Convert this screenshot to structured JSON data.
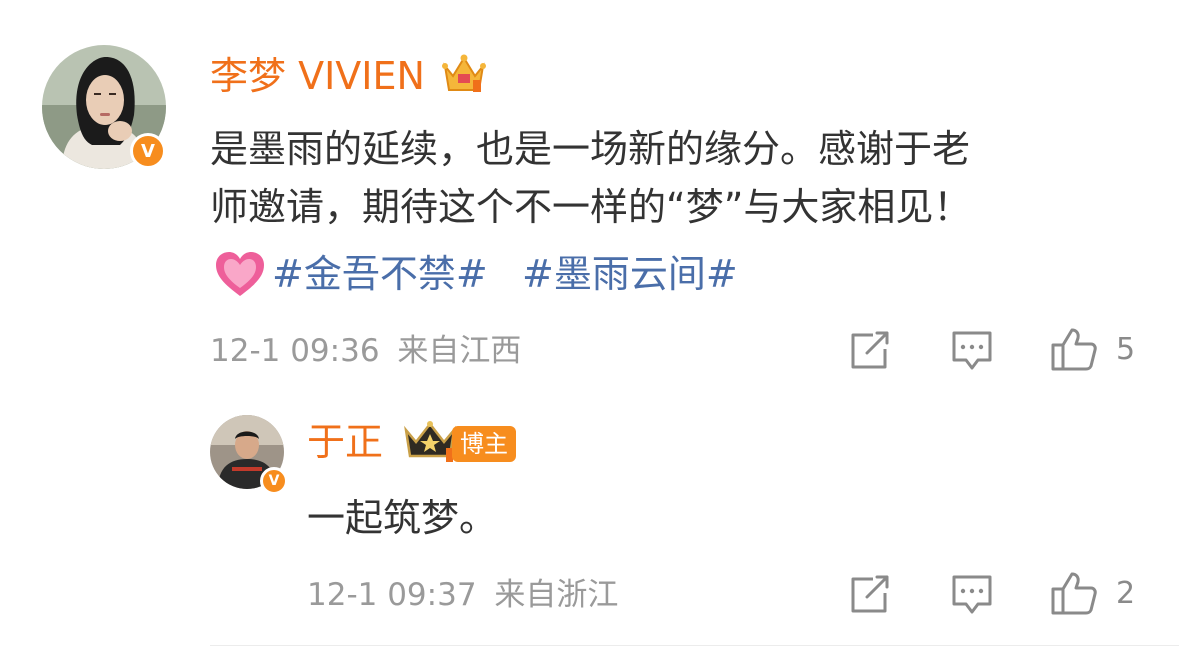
{
  "comment1": {
    "username": "李梦 VIVIEN",
    "content_line1": "是墨雨的延续，也是一场新的缘分。感谢于老",
    "content_line2": "师邀请，期待这个不一样的“梦”与大家相见！",
    "hashtag1": "#金吾不禁#",
    "hashtag2": "#墨雨云间#",
    "timestamp": "12-1 09:36",
    "location": "来自江西",
    "like_count": "5",
    "verified_badge": "V"
  },
  "reply1": {
    "username": "于正",
    "badge_label": "博主",
    "content": "一起筑梦。",
    "timestamp": "12-1 09:37",
    "location": "来自浙江",
    "like_count": "2",
    "verified_badge": "V"
  },
  "icons": [
    "crown-icon",
    "heart-emoji-icon",
    "share-icon",
    "comment-icon",
    "like-icon"
  ],
  "colors": {
    "username": "#f0701a",
    "hashtag": "#4a6ea9",
    "text": "#333333",
    "meta": "#9a9a9a",
    "badge_bg": "#f78d1e"
  }
}
